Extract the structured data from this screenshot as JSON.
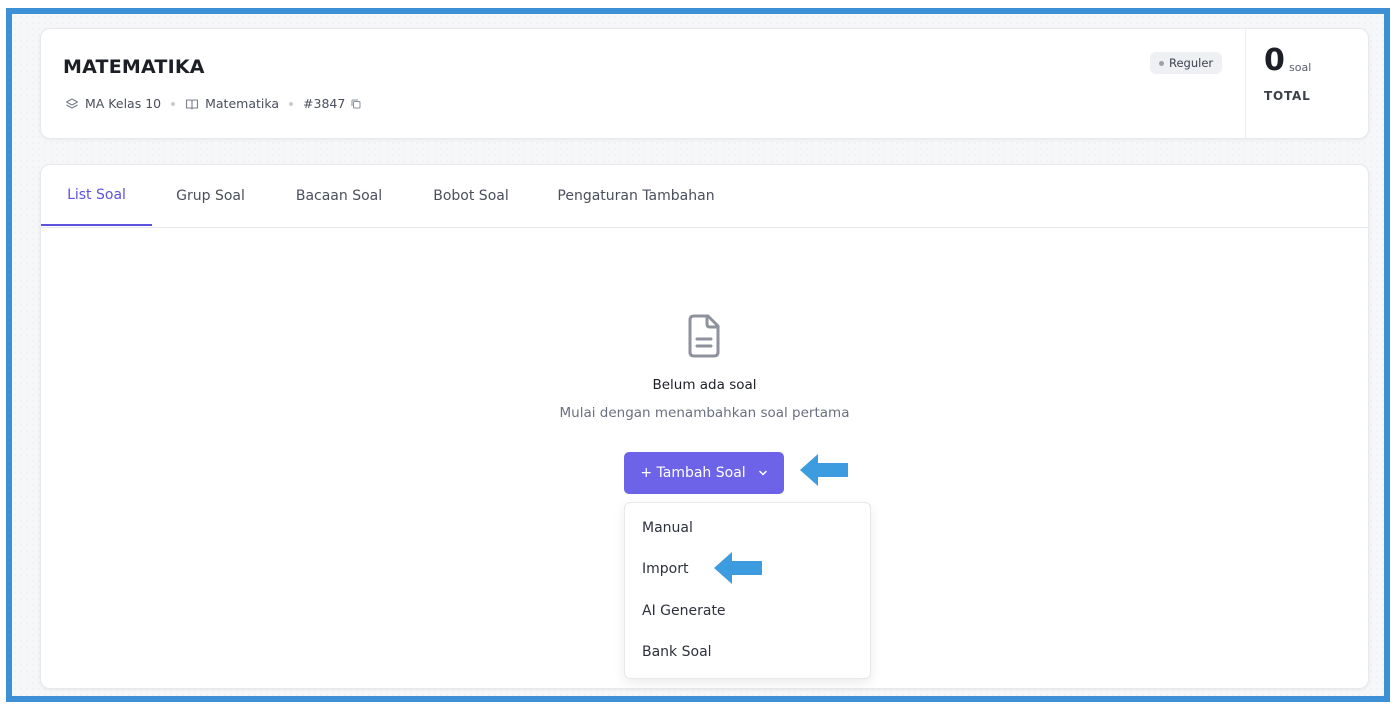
{
  "header": {
    "title": "MATEMATIKA",
    "class_label": "MA Kelas 10",
    "subject_label": "Matematika",
    "id_label": "#3847",
    "badge": "Reguler",
    "total_count": "0",
    "total_unit": "soal",
    "total_label": "TOTAL"
  },
  "tabs": [
    {
      "label": "List Soal",
      "active": true
    },
    {
      "label": "Grup Soal"
    },
    {
      "label": "Bacaan Soal"
    },
    {
      "label": "Bobot Soal"
    },
    {
      "label": "Pengaturan Tambahan"
    }
  ],
  "empty_state": {
    "icon": "document-icon",
    "title": "Belum ada soal",
    "subtitle": "Mulai dengan menambahkan soal pertama"
  },
  "add_button": {
    "label": "+ Tambah Soal"
  },
  "dropdown": {
    "items": [
      {
        "label": "Manual"
      },
      {
        "label": "Import"
      },
      {
        "label": "AI Generate"
      },
      {
        "label": "Bank Soal"
      }
    ]
  },
  "colors": {
    "accent": "#6c63e8",
    "active_tab": "#5b52e0",
    "frame_border": "#3d8fd6",
    "annotation_arrow": "#3d9be0"
  }
}
